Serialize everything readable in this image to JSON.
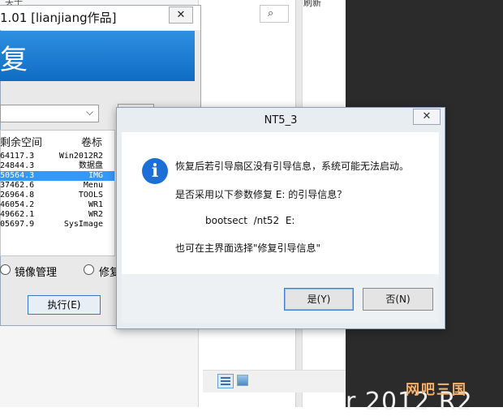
{
  "background": {
    "top_left_text": "关于",
    "refresh_text": "刷新",
    "search_icon": "search-icon",
    "view_icons": [
      "details-view-icon",
      "tiles-view-icon"
    ],
    "desktop_text": "r 2012 R2",
    "watermark": "网吧三国"
  },
  "tool_window": {
    "title": "1.01 [lianjiang作品]",
    "close_label": "✕",
    "banner_text": "复",
    "columns": {
      "free_space": "剩余空间",
      "volume": "卷标"
    },
    "rows": [
      {
        "free": "64117.3",
        "volume": "Win2012R2",
        "selected": false
      },
      {
        "free": "24844.3",
        "volume": "数据盘",
        "selected": false
      },
      {
        "free": "50564.3",
        "volume": "IMG",
        "selected": true
      },
      {
        "free": "37462.6",
        "volume": "Menu",
        "selected": false
      },
      {
        "free": "26964.8",
        "volume": "TOOLS",
        "selected": false
      },
      {
        "free": "46054.2",
        "volume": "WR1",
        "selected": false
      },
      {
        "free": "49662.1",
        "volume": "WR2",
        "selected": false
      },
      {
        "free": "05697.9",
        "volume": "SysImage",
        "selected": false
      }
    ],
    "options": {
      "mirror_label": "镜像管理",
      "repair_label": "修复"
    },
    "execute_label": "执行(E)"
  },
  "dialog": {
    "title": "NT5_3",
    "close_label": "✕",
    "icon": "info-icon",
    "lines": [
      "恢复后若引导扇区没有引导信息，系统可能无法启动。",
      "是否采用以下参数修复 E: 的引导信息？",
      "bootsect  /nt52  E:",
      "也可在主界面选择\"修复引导信息\""
    ],
    "yes_label": "是(Y)",
    "no_label": "否(N)"
  },
  "colors": {
    "accent": "#1b6fd6",
    "selection": "#3399ff",
    "banner": "#0f6cc4",
    "desktop": "#2b2b2b",
    "watermark": "#f6b26b"
  }
}
